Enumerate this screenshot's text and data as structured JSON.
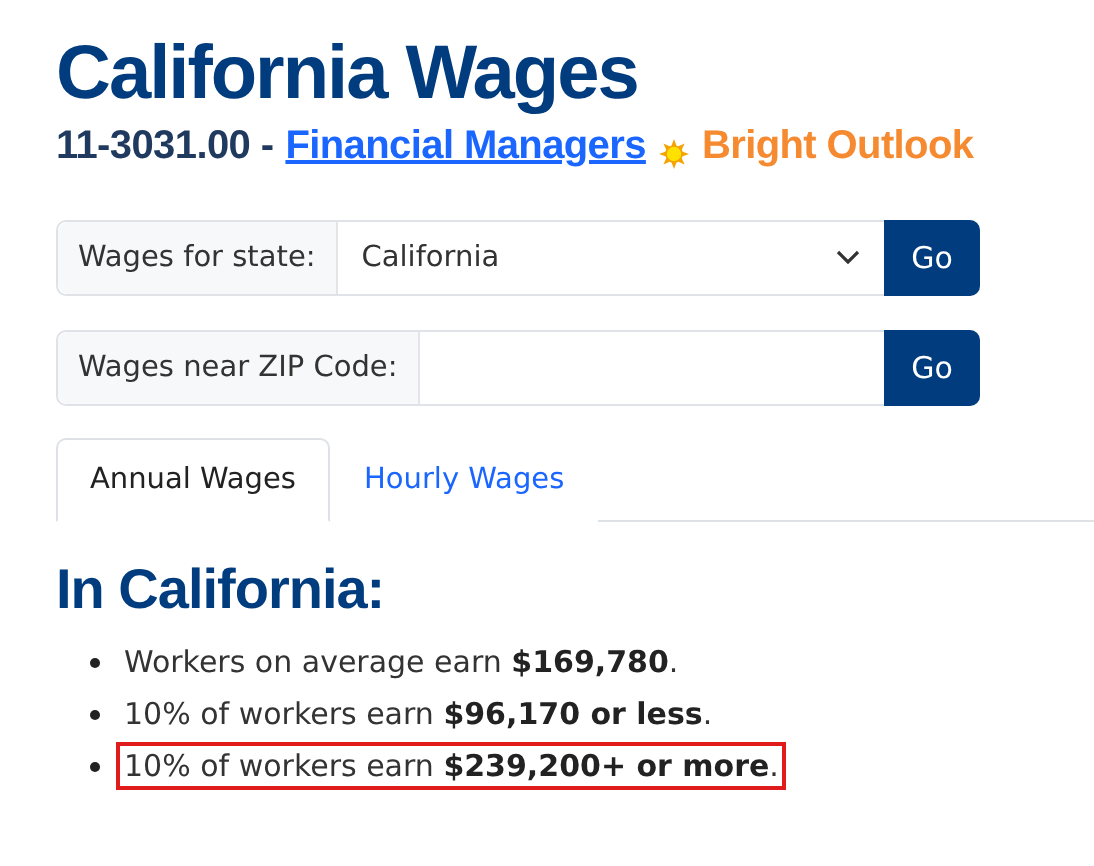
{
  "title": "California Wages",
  "subtitle": {
    "code": "11-3031.00 -",
    "occupation_link": "Financial Managers",
    "badge": "Bright Outlook"
  },
  "forms": [
    {
      "kind": "select",
      "label": "Wages for state:",
      "value": "California",
      "button": "Go"
    },
    {
      "kind": "input",
      "label": "Wages near ZIP Code:",
      "button": "Go"
    }
  ],
  "tabs": [
    {
      "label": "Annual Wages",
      "selected": true
    },
    {
      "label": "Hourly Wages",
      "selected": false
    }
  ],
  "section_heading": "In California:",
  "facts": [
    {
      "text": "Workers on average earn **$169,780**.",
      "highlighted": false
    },
    {
      "text": "10% of workers earn **$96,170 or less**.",
      "highlighted": false
    },
    {
      "text": "10% of workers earn **$239,200+ or more**.",
      "highlighted": true
    }
  ]
}
